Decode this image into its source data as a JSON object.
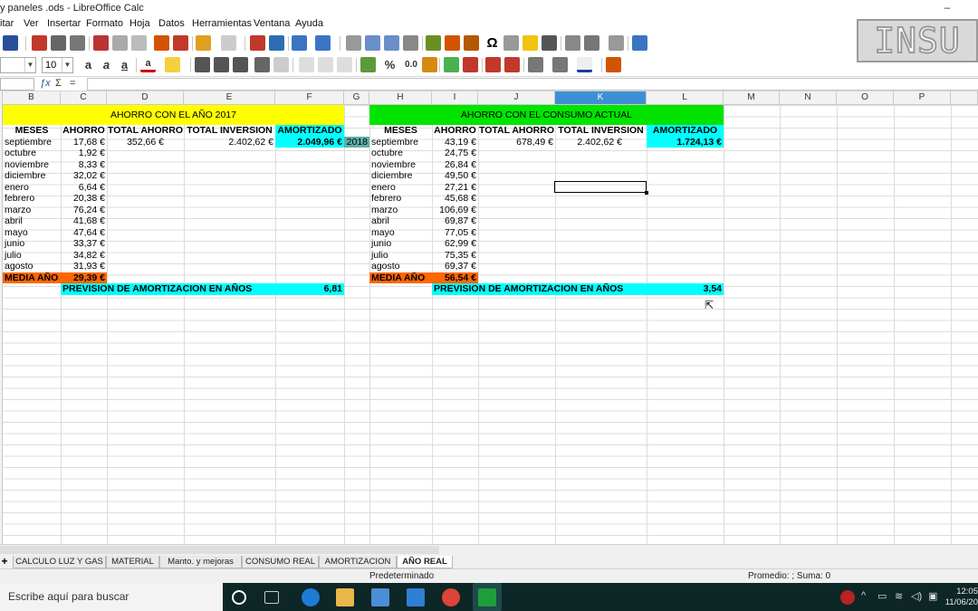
{
  "window": {
    "title": "y paneles .ods - LibreOffice Calc",
    "minimize": "–",
    "restore": "☐"
  },
  "logo": {
    "text": "INSU"
  },
  "menu": [
    "itar",
    "Ver",
    "Insertar",
    "Formato",
    "Hoja",
    "Datos",
    "Herramientas",
    "Ventana",
    "Ayuda"
  ],
  "toolbar": {
    "font_name": "",
    "font_size": "10",
    "percent": "%",
    "decimal": "0.0"
  },
  "formula_bar": {
    "cell_ref": "",
    "sum_symbol": "Σ",
    "equals_symbol": "=",
    "formula": ""
  },
  "columns": [
    "B",
    "C",
    "D",
    "E",
    "F",
    "G",
    "H",
    "I",
    "J",
    "K",
    "L",
    "M",
    "N",
    "O",
    "P"
  ],
  "selected_column": "K",
  "colors": {
    "yellow": "#ffff00",
    "green": "#00e400",
    "cyan": "#00ffff",
    "orange": "#ff6600",
    "teal_selected": "#00a0a0",
    "header_selected": "#3f8fd6"
  },
  "left_table": {
    "title": "AHORRO CON EL AÑO 2017",
    "headers": [
      "MESES",
      "AHORRO",
      "TOTAL AHORRO",
      "TOTAL INVERSION",
      "AMORTIZADO"
    ],
    "total_ahorro": "352,66 €",
    "total_inversion": "2.402,62 €",
    "amortizado": "2.049,96 €",
    "year_marker": "2018",
    "rows": [
      [
        "septiembre",
        "17,68 €"
      ],
      [
        "octubre",
        "1,92 €"
      ],
      [
        "noviembre",
        "8,33 €"
      ],
      [
        "diciembre",
        "32,02 €"
      ],
      [
        "enero",
        "6,64 €"
      ],
      [
        "febrero",
        "20,38 €"
      ],
      [
        "marzo",
        "76,24 €"
      ],
      [
        "abril",
        "41,68 €"
      ],
      [
        "mayo",
        "47,64 €"
      ],
      [
        "junio",
        "33,37 €"
      ],
      [
        "julio",
        "34,82 €"
      ],
      [
        "agosto",
        "31,93 €"
      ]
    ],
    "media_label": "MEDIA AÑO",
    "media_value": "29,39 €",
    "prevision_label": "PREVISION DE AMORTIZACION EN AÑOS",
    "prevision_value": "6,81"
  },
  "right_table": {
    "title": "AHORRO CON EL CONSUMO ACTUAL",
    "headers": [
      "MESES",
      "AHORRO",
      "TOTAL AHORRO",
      "TOTAL INVERSION",
      "AMORTIZADO"
    ],
    "total_ahorro": "678,49 €",
    "total_inversion": "2.402,62 €",
    "amortizado": "1.724,13 €",
    "rows": [
      [
        "septiembre",
        "43,19 €"
      ],
      [
        "octubre",
        "24,75 €"
      ],
      [
        "noviembre",
        "26,84 €"
      ],
      [
        "diciembre",
        "49,50 €"
      ],
      [
        "enero",
        "27,21 €"
      ],
      [
        "febrero",
        "45,68 €"
      ],
      [
        "marzo",
        "106,69 €"
      ],
      [
        "abril",
        "69,87 €"
      ],
      [
        "mayo",
        "77,05 €"
      ],
      [
        "junio",
        "62,99 €"
      ],
      [
        "julio",
        "75,35 €"
      ],
      [
        "agosto",
        "69,37 €"
      ]
    ],
    "media_label": "MEDIA AÑO",
    "media_value": "56,54 €",
    "prevision_label": "PREVISION DE AMORTIZACION EN AÑOS",
    "prevision_value": "3,54"
  },
  "sheet_tabs": [
    "CALCULO LUZ Y GAS",
    "MATERIAL",
    "Manto. y mejoras",
    "CONSUMO REAL",
    "AMORTIZACION",
    "AÑO REAL"
  ],
  "active_tab": "AÑO REAL",
  "add_tab": "+",
  "status": {
    "style": "Predeterminado",
    "stats": "Promedio: ; Suma: 0"
  },
  "taskbar": {
    "search_placeholder": "Escribe aquí para buscar",
    "time": "12:05",
    "date": "11/06/20"
  }
}
